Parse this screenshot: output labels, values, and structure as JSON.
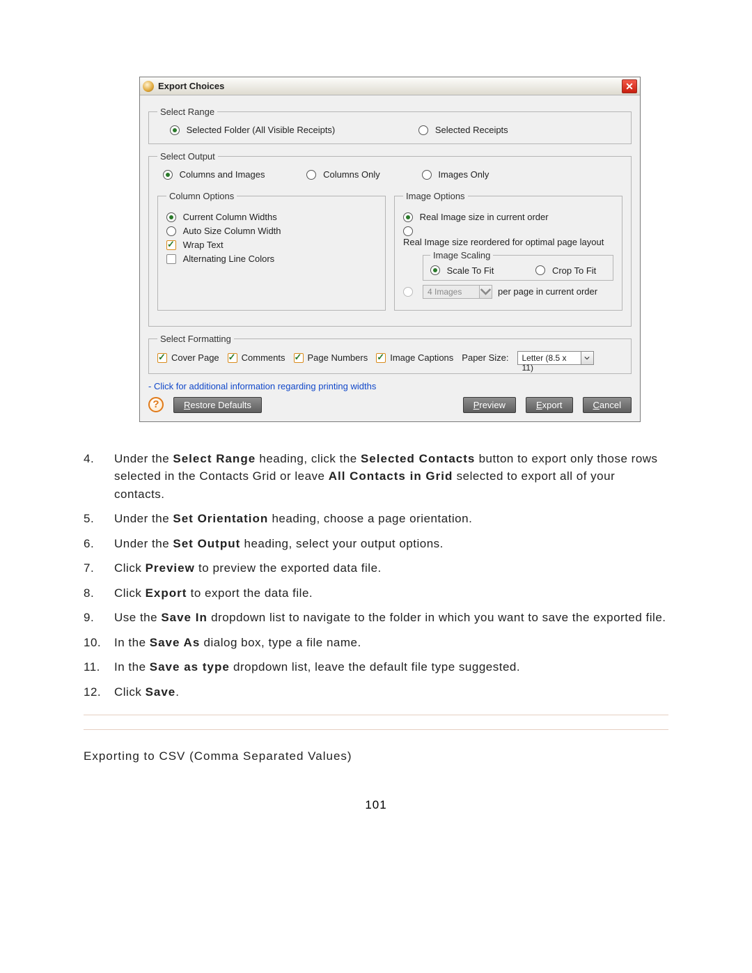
{
  "dialog": {
    "title": "Export Choices",
    "select_range": {
      "legend": "Select Range",
      "opt1": "Selected Folder (All Visible Receipts)",
      "opt2": "Selected Receipts"
    },
    "select_output": {
      "legend": "Select Output",
      "opt1": "Columns and Images",
      "opt2": "Columns Only",
      "opt3": "Images Only"
    },
    "column_options": {
      "legend": "Column Options",
      "opt1": "Current Column Widths",
      "opt2": "Auto Size Column Width",
      "chk1": "Wrap Text",
      "chk2": "Alternating Line Colors"
    },
    "image_options": {
      "legend": "Image Options",
      "opt1": "Real Image size in current order",
      "opt2": "Real Image size reordered for optimal page layout",
      "scaling_legend": "Image Scaling",
      "scale_opt1": "Scale To Fit",
      "scale_opt2": "Crop To Fit",
      "per_page_select": "4 Images",
      "per_page_label": "per page in current order"
    },
    "formatting": {
      "legend": "Select Formatting",
      "cover": "Cover Page",
      "comments": "Comments",
      "pagenums": "Page Numbers",
      "captions": "Image Captions",
      "paper_label": "Paper Size:",
      "paper_value": "Letter (8.5 x 11)"
    },
    "link_text": "- Click for additional information regarding printing widths",
    "buttons": {
      "restore": "Restore Defaults",
      "preview": "Preview",
      "export": "Export",
      "cancel": "Cancel"
    }
  },
  "steps": {
    "s4": "Under the Select Range heading, click the Selected Contacts button to export only those rows selected in the Contacts Grid or leave All Contacts in Grid selected to export all of your contacts.",
    "s5": "Under the Set Orientation heading, choose a page orientation.",
    "s6": "Under the Set Output heading, select your output options.",
    "s7": "Click Preview to preview the exported data file.",
    "s8": "Click Export to export the data file.",
    "s9": "Use the Save In dropdown list to navigate to the folder in which you want to save the exported file.",
    "s10": "In the Save As dialog box, type a file name.",
    "s11": "In the Save as type dropdown list, leave the default file type suggested.",
    "s12": "Click Save."
  },
  "heading": "Exporting to CSV (Comma Separated Values)",
  "page_number": "101"
}
